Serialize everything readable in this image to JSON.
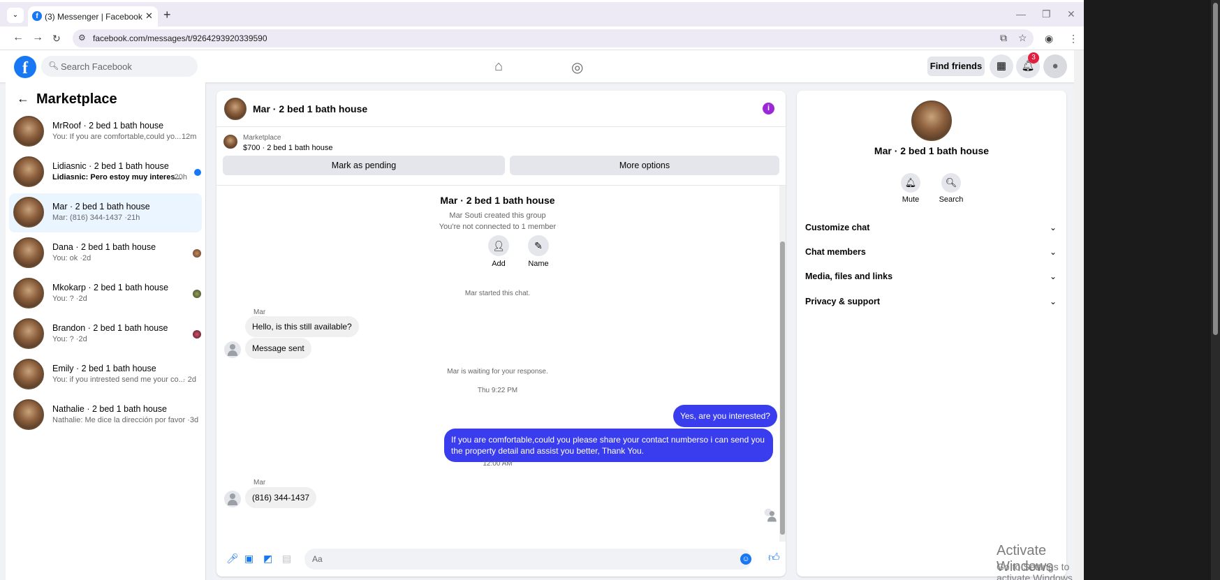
{
  "browser": {
    "tab_title": "(3) Messenger | Facebook",
    "url": "facebook.com/messages/t/9264293920339590"
  },
  "header": {
    "search_placeholder": "Search Facebook",
    "find_friends": "Find friends",
    "notifications_count": "3"
  },
  "sidebar": {
    "title": "Marketplace",
    "conversations": [
      {
        "name": "MrRoof · 2 bed 1 bath house",
        "preview": "You: If you are comfortable,could yo...",
        "time": "12m"
      },
      {
        "name": "Lidiasnic · 2 bed 1 bath house",
        "preview": "Lidiasnic: Pero estoy muy interes...",
        "time": "·20h"
      },
      {
        "name": "Mar · 2 bed 1 bath house",
        "preview": "Mar: (816) 344-1437 ·21h",
        "time": ""
      },
      {
        "name": "Dana · 2 bed 1 bath house",
        "preview": "You: ok ·2d",
        "time": ""
      },
      {
        "name": "Mkokarp · 2 bed 1 bath house",
        "preview": "You: ? ·2d",
        "time": ""
      },
      {
        "name": "Brandon · 2 bed 1 bath house",
        "preview": "You: ? ·2d",
        "time": ""
      },
      {
        "name": "Emily · 2 bed 1 bath house",
        "preview": "You: if you intrested send me your co...",
        "time": "· 2d"
      },
      {
        "name": "Nathalie · 2 bed 1 bath house",
        "preview": "Nathalie: Me dice la dirección por favor ·3d",
        "time": ""
      }
    ]
  },
  "chat": {
    "title": "Mar · 2 bed 1 bath house",
    "listing_label": "Marketplace",
    "listing_price": "$700 · 2 bed 1 bath house",
    "mark_pending": "Mark as pending",
    "more_options": "More options",
    "group_title": "Mar · 2 bed 1 bath house",
    "created_note": "Mar Souti created this group",
    "not_connected": "You're not connected to 1 member",
    "add_label": "Add",
    "name_label": "Name",
    "started_note": "Mar started this chat.",
    "sender1": "Mar",
    "msg1": "Hello, is this still available?",
    "msg2": "Message sent",
    "waiting_note": "Mar is waiting for your response.",
    "time1": "Thu 9:22 PM",
    "out1": "Yes, are you interested?",
    "out2": "If you are comfortable,could you please share your contact numberso i can send you the property detail and assist you better, Thank You.",
    "time2": "12:00 AM",
    "sender2": "Mar",
    "msg3": "(816) 344-1437",
    "composer_placeholder": "Aa"
  },
  "details": {
    "title": "Mar · 2 bed 1 bath house",
    "mute": "Mute",
    "search": "Search",
    "sections": [
      "Customize chat",
      "Chat members",
      "Media, files and links",
      "Privacy & support"
    ]
  },
  "watermark": {
    "line1": "Activate Windows",
    "line2": "Go to Settings to activate Windows."
  }
}
